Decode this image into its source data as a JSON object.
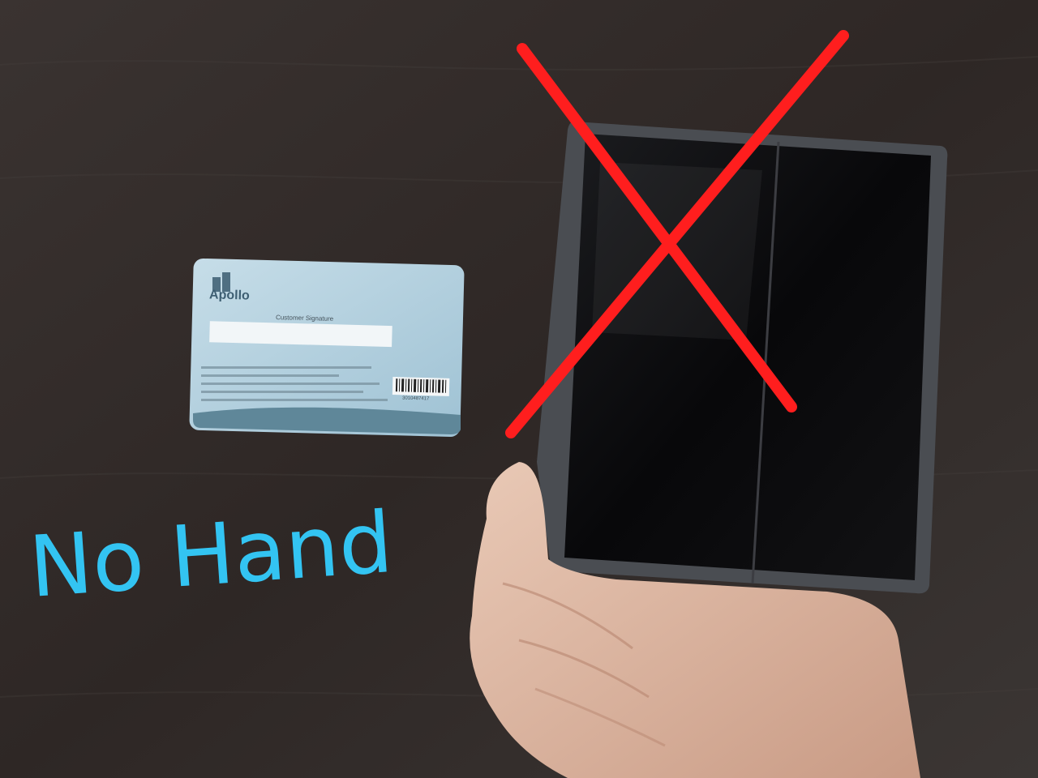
{
  "overlay": {
    "caption": "No Hand",
    "caption_color": "#33c4f2",
    "cross_color": "#ff1e1e"
  },
  "card": {
    "brand": "Apollo",
    "signature_label": "Customer Signature",
    "barcode_number": "3010487417"
  },
  "scene": {
    "background_color": "#2f2826",
    "box_color": "#0c0c0e",
    "card_color": "#b8d4e2"
  }
}
